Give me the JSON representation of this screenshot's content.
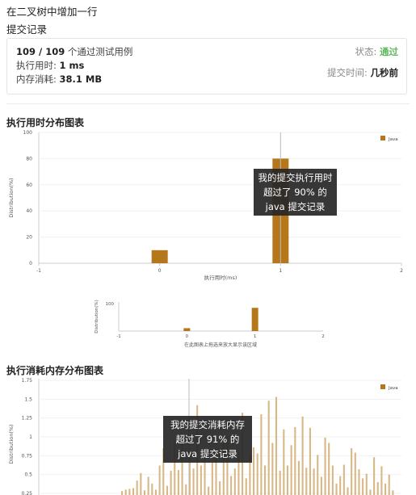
{
  "page": {
    "title": "在二叉树中增加一行"
  },
  "submission": {
    "section_title": "提交记录",
    "passed": "109 / 109",
    "passed_suffix": " 个通过测试用例",
    "runtime_label": "执行用时: ",
    "runtime_value": "1 ms",
    "memory_label": "内存消耗: ",
    "memory_value": "38.1 MB",
    "status_label": "状态: ",
    "status_value": "通过",
    "time_label": "提交时间: ",
    "time_value": "几秒前",
    "status_color": "#5cb85c"
  },
  "runtime_chart": {
    "title": "执行用时分布图表",
    "tooltip": [
      "我的提交执行用时",
      "超过了 90% 的",
      "java 提交记录"
    ],
    "overview_xlabel": "在此图表上拖选来放大显示该区域"
  },
  "memory_chart": {
    "title": "执行消耗内存分布图表",
    "tooltip": [
      "我的提交消耗内存",
      "超过了 91% 的",
      "java 提交记录"
    ]
  },
  "chart_data": [
    {
      "type": "bar",
      "xlabel": "执行用时(ms)",
      "ylabel": "Distribution(%)",
      "legend": [
        "Java"
      ],
      "legend_position": "top-right",
      "x_ticks": [
        "-1",
        "0",
        "1",
        "2"
      ],
      "y_ticks": [
        "0",
        "20",
        "40",
        "60",
        "80",
        "100"
      ],
      "xlim": [
        -1,
        2
      ],
      "ylim": [
        0,
        100
      ],
      "x": [
        0,
        1
      ],
      "values": [
        10,
        80
      ],
      "color": "#b5771b",
      "marker_x": 1
    },
    {
      "type": "bar",
      "xlabel": "在此图表上拖选来放大显示该区域",
      "ylabel": "Distribution(%)",
      "x_ticks": [
        "-1",
        "0",
        "1",
        "2"
      ],
      "y_ticks": [
        "100"
      ],
      "xlim": [
        -1,
        2
      ],
      "ylim": [
        0,
        100
      ],
      "x": [
        0,
        1
      ],
      "values": [
        10,
        80
      ],
      "color": "#b5771b"
    },
    {
      "type": "bar",
      "ylabel": "Distribution(%)",
      "legend": [
        "Java"
      ],
      "legend_position": "top-right",
      "y_ticks": [
        "0.25",
        "0.5",
        "0.75",
        "1",
        "1.25",
        "1.5",
        "1.75"
      ],
      "ylim": [
        0.25,
        1.75
      ],
      "values": [
        0.28,
        0.3,
        0.31,
        0.32,
        0.42,
        0.52,
        0.29,
        0.47,
        0.38,
        0.3,
        0.62,
        0.85,
        0.35,
        0.55,
        0.95,
        0.56,
        1.05,
        0.37,
        0.72,
        0.58,
        1.42,
        0.62,
        0.78,
        0.34,
        0.66,
        0.74,
        0.41,
        0.93,
        0.98,
        0.48,
        0.58,
        0.8,
        1.32,
        0.45,
        0.75,
        0.86,
        0.78,
        1.3,
        0.62,
        1.48,
        0.92,
        1.53,
        0.55,
        1.1,
        0.62,
        0.89,
        1.13,
        0.68,
        1.27,
        0.59,
        1.12,
        0.58,
        0.76,
        0.47,
        0.99,
        0.92,
        0.62,
        0.38,
        0.48,
        0.63,
        0.33,
        0.85,
        0.79,
        0.57,
        0.45,
        0.51,
        0.3,
        0.73,
        0.4,
        0.61,
        0.38,
        0.5,
        0.29
      ],
      "color": "#d7b886",
      "highlight_color": "#b5771b"
    }
  ]
}
